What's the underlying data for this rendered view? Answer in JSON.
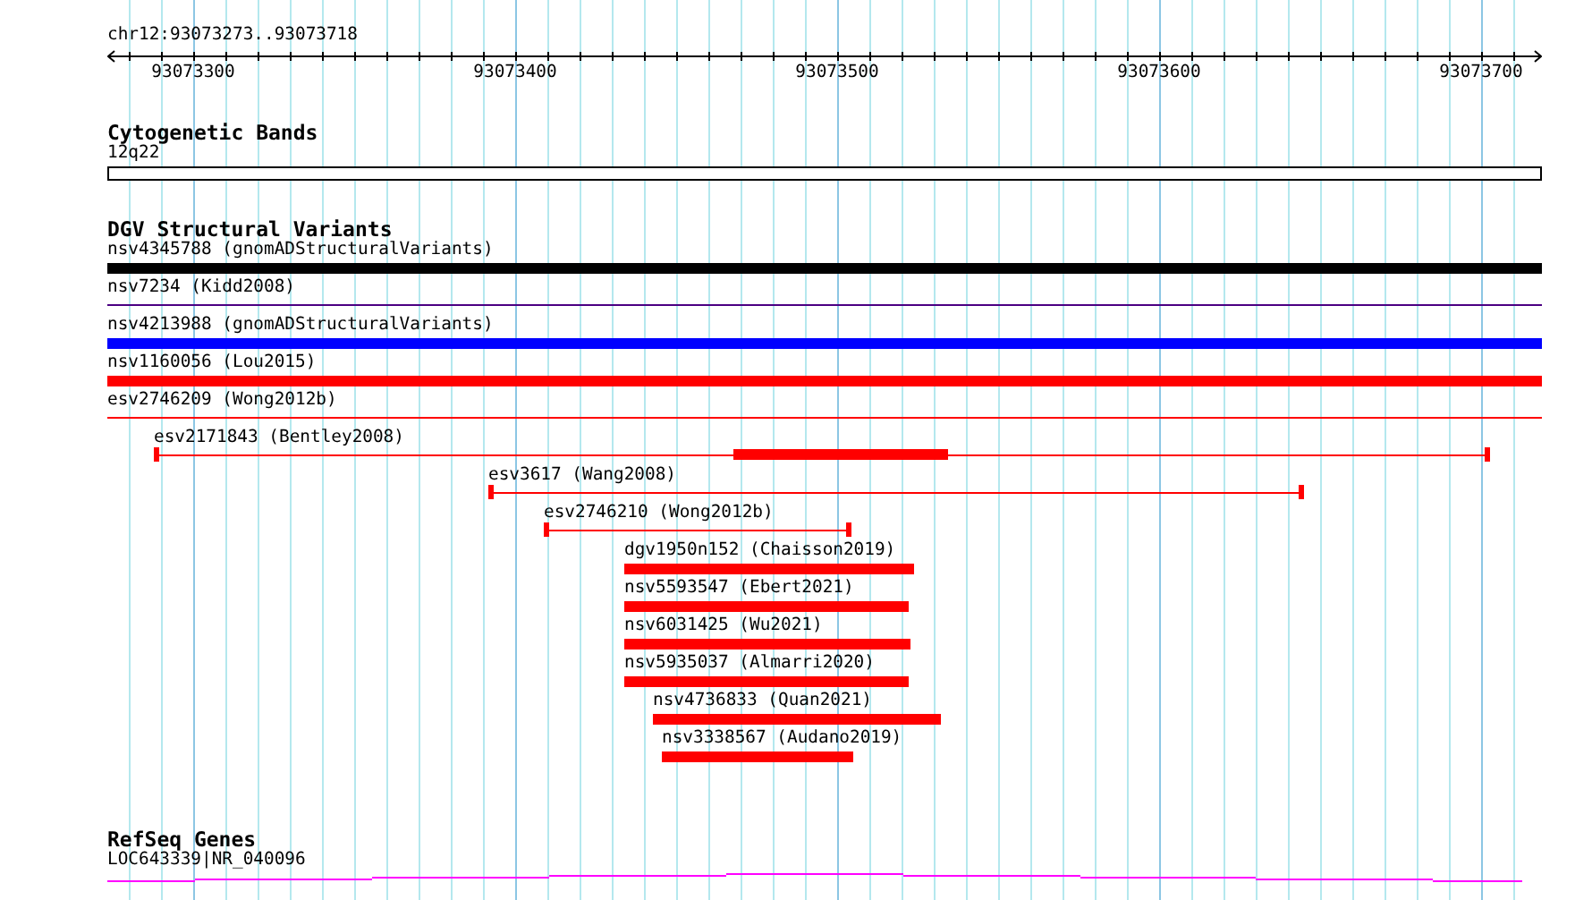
{
  "ruler": {
    "location": "chr12:93073273..93073718",
    "ticks": [
      "93073300",
      "93073400",
      "93073500",
      "93073600",
      "93073700"
    ]
  },
  "tracks": [
    {
      "kind": "bands",
      "title": "Cytogenetic Bands",
      "features": [
        {
          "label": "12q22"
        }
      ]
    },
    {
      "kind": "variants",
      "title": "DGV Structural Variants",
      "features": [
        {
          "label": "nsv4345788 (gnomADStructuralVariants)",
          "kind": "bar",
          "color": "#000000"
        },
        {
          "label": "nsv7234 (Kidd2008)",
          "kind": "line",
          "color": "#4b0082"
        },
        {
          "label": "nsv4213988 (gnomADStructuralVariants)",
          "kind": "bar",
          "color": "#0000ff"
        },
        {
          "label": "nsv1160056 (Lou2015)",
          "kind": "bar",
          "color": "#ff0000"
        },
        {
          "label": "esv2746209 (Wong2012b)",
          "kind": "line",
          "color": "#ff0000"
        },
        {
          "label": "esv2171843 (Bentley2008)",
          "kind": "span",
          "color": "#ff0000"
        },
        {
          "label": "esv3617 (Wang2008)",
          "kind": "span",
          "color": "#ff0000"
        },
        {
          "label": "esv2746210 (Wong2012b)",
          "kind": "span",
          "color": "#ff0000"
        },
        {
          "label": "dgv1950n152 (Chaisson2019)",
          "kind": "bar",
          "color": "#ff0000"
        },
        {
          "label": "nsv5593547 (Ebert2021)",
          "kind": "bar",
          "color": "#ff0000"
        },
        {
          "label": "nsv6031425 (Wu2021)",
          "kind": "bar",
          "color": "#ff0000"
        },
        {
          "label": "nsv5935037 (Almarri2020)",
          "kind": "bar",
          "color": "#ff0000"
        },
        {
          "label": "nsv4736833 (Quan2021)",
          "kind": "bar",
          "color": "#ff0000"
        },
        {
          "label": "nsv3338567 (Audano2019)",
          "kind": "bar",
          "color": "#ff0000"
        }
      ]
    },
    {
      "kind": "genes",
      "title": "RefSeq Genes",
      "features": [
        {
          "label": "LOC643339|NR_040096"
        }
      ]
    }
  ]
}
